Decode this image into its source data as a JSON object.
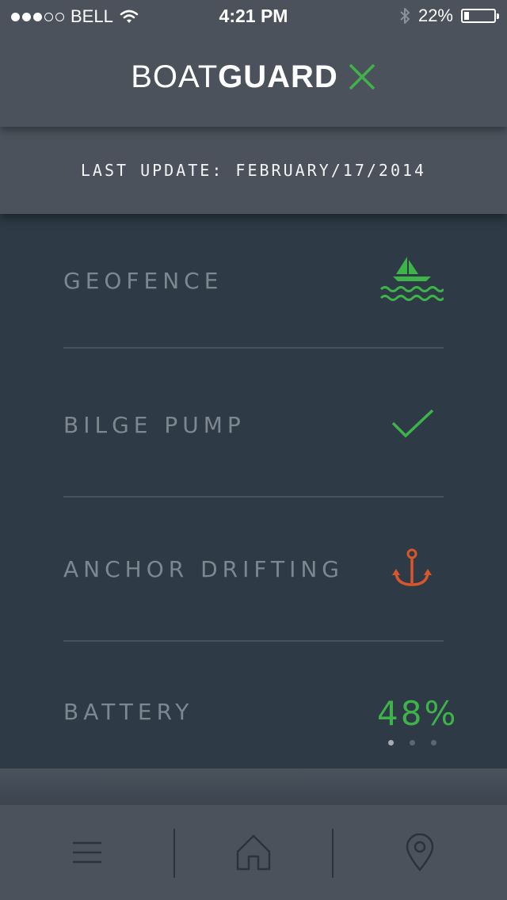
{
  "status_bar": {
    "carrier": "BELL",
    "time": "4:21 PM",
    "battery_percent": "22%",
    "signal_bars_filled": 3,
    "signal_bars_total": 5,
    "battery_level": 0.22
  },
  "header": {
    "brand_light": "BOAT",
    "brand_bold": "GUARD",
    "logo_icon": "x-mark-icon",
    "accent": "#3db34a"
  },
  "last_update": "LAST UPDATE: FEBRUARY/17/2014",
  "items": [
    {
      "label": "GEOFENCE",
      "icon": "sailboat-waves-icon",
      "color": "#3db34a"
    },
    {
      "label": "BILGE PUMP",
      "icon": "checkmark-icon",
      "color": "#3db34a"
    },
    {
      "label": "ANCHOR DRIFTING",
      "icon": "anchor-icon",
      "color": "#d9562a"
    },
    {
      "label": "BATTERY",
      "value": "48%",
      "color": "#3db34a"
    }
  ],
  "pager": {
    "count": 3,
    "active": 0
  },
  "tabbar": {
    "tabs": [
      {
        "icon": "menu-icon"
      },
      {
        "icon": "home-icon"
      },
      {
        "icon": "location-pin-icon"
      }
    ]
  }
}
